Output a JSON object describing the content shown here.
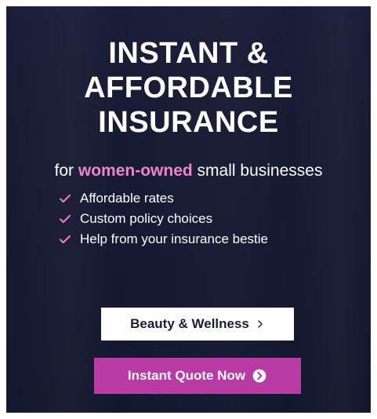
{
  "ad": {
    "headline_lines": [
      "INSTANT &",
      "AFFORDABLE",
      "INSURANCE"
    ],
    "subhead_prefix": "for ",
    "subhead_accent": "women-owned",
    "subhead_suffix": " small businesses",
    "benefits": [
      "Affordable rates",
      "Custom policy choices",
      "Help from your insurance bestie"
    ],
    "secondary_button_label": "Beauty & Wellness",
    "primary_button_label": "Instant Quote Now"
  },
  "icons": {
    "benefit_check": "check-icon",
    "secondary_button_icon": "chevron-right-icon",
    "primary_button_icon": "circle-arrow-right-icon"
  },
  "colors": {
    "background": "#1b1c38",
    "accent": "#f083c9",
    "primary_button": "#b93aa4",
    "secondary_button": "#ffffff",
    "text_light": "#ffffff",
    "text_dark": "#1b1c38"
  }
}
